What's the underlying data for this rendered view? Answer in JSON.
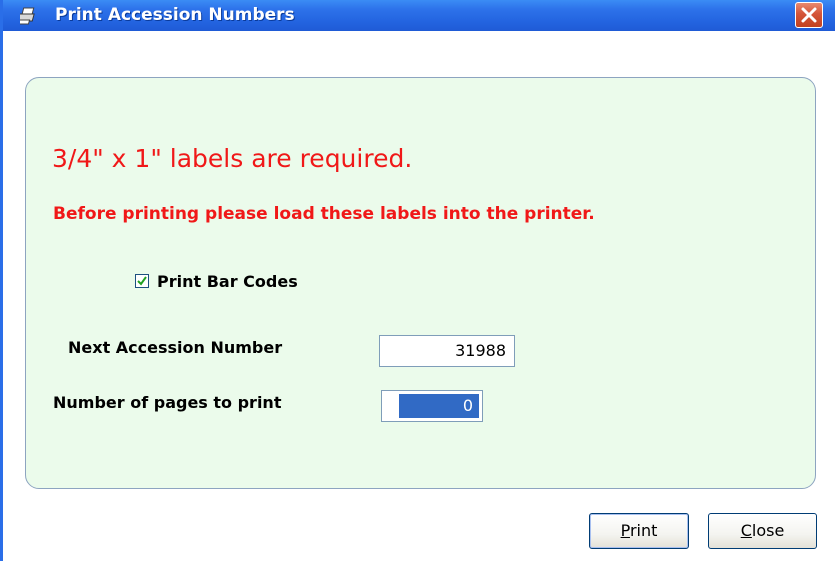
{
  "window": {
    "title": "Print Accession Numbers",
    "icon": "printer-icon",
    "close_label": "×"
  },
  "panel": {
    "heading": "3/4\" x 1\" labels are required.",
    "subheading": "Before printing please load these labels into the printer.",
    "print_barcodes": {
      "label": "Print Bar Codes",
      "checked": true
    },
    "next_accession": {
      "label": "Next Accession Number",
      "value": "31988"
    },
    "pages_to_print": {
      "label": "Number of pages to print",
      "value": "0"
    }
  },
  "buttons": {
    "print_first": "P",
    "print_rest": "rint",
    "close_first": "C",
    "close_rest": "lose"
  },
  "colors": {
    "titlebar": "#2364e0",
    "panel_bg": "#ebfbeb",
    "warning_text": "#f01818",
    "selection": "#316ac5"
  }
}
